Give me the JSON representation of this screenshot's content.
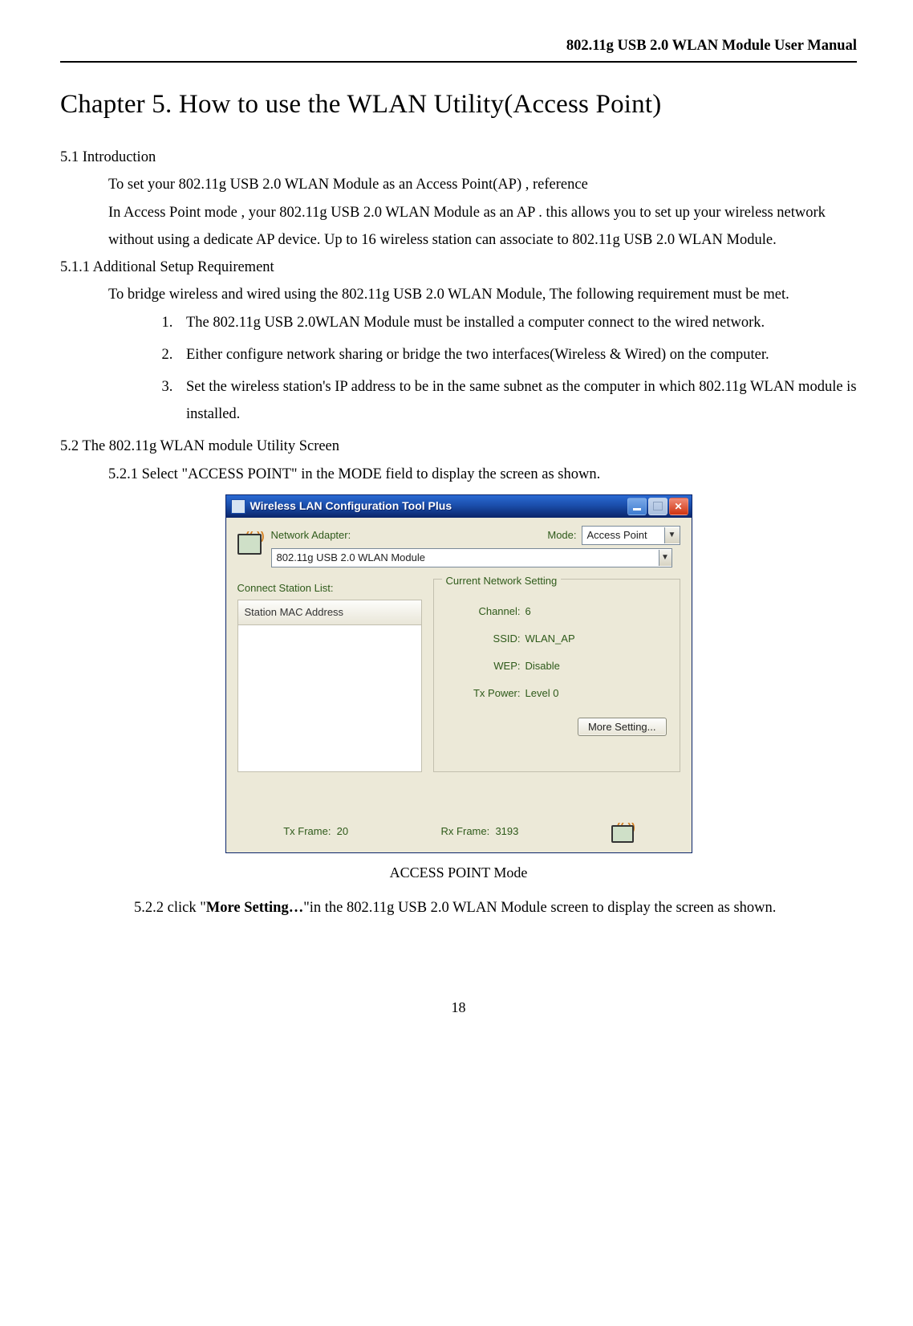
{
  "header": {
    "right": "802.11g USB 2.0 WLAN Module User Manual"
  },
  "chapter": {
    "title": "Chapter 5. How to use the WLAN Utility(Access Point)"
  },
  "s51": {
    "heading": "5.1 Introduction",
    "p1": "To set your 802.11g USB 2.0 WLAN Module as an Access Point(AP) , reference",
    "p2": "In Access Point mode , your 802.11g USB 2.0 WLAN Module as an AP . this allows you to set up your wireless network without using a dedicate AP device. Up to 16 wireless station can associate to 802.11g USB 2.0 WLAN Module."
  },
  "s511": {
    "heading": "5.1.1 Additional Setup Requirement",
    "p1": "To bridge wireless and wired using the 802.11g USB 2.0 WLAN Module, The following requirement must be met.",
    "li1": "The 802.11g USB 2.0WLAN Module must be installed a computer connect to the wired network.",
    "li2": "Either configure network sharing or bridge the two interfaces(Wireless & Wired) on the computer.",
    "li3": "Set the wireless station's IP address to be in the same subnet as the computer in which 802.11g WLAN module is installed."
  },
  "s52": {
    "heading": "5.2 The 802.11g WLAN module Utility Screen",
    "s521": "5.2.1 Select \"ACCESS POINT\" in the MODE field to display the screen as shown."
  },
  "dialog": {
    "title": "Wireless LAN Configuration Tool Plus",
    "adapter_label": "Network Adapter:",
    "adapter_value": "802.11g USB 2.0 WLAN Module",
    "mode_label": "Mode:",
    "mode_value": "Access Point",
    "station_caption": "Connect Station List:",
    "station_header": "Station MAC Address",
    "group_legend": "Current Network Setting",
    "channel_k": "Channel:",
    "channel_v": "6",
    "ssid_k": "SSID:",
    "ssid_v": "WLAN_AP",
    "wep_k": "WEP:",
    "wep_v": "Disable",
    "txp_k": "Tx Power:",
    "txp_v": "Level 0",
    "more_btn": "More Setting...",
    "txframe_k": "Tx Frame:",
    "txframe_v": "20",
    "rxframe_k": "Rx Frame:",
    "rxframe_v": "3193"
  },
  "caption": "ACCESS POINT Mode",
  "s522_a": "5.2.2 click \"",
  "s522_bold": "More Setting…",
  "s522_b": "\"in the 802.11g USB 2.0 WLAN Module screen to display the screen as shown.",
  "page_number": "18"
}
